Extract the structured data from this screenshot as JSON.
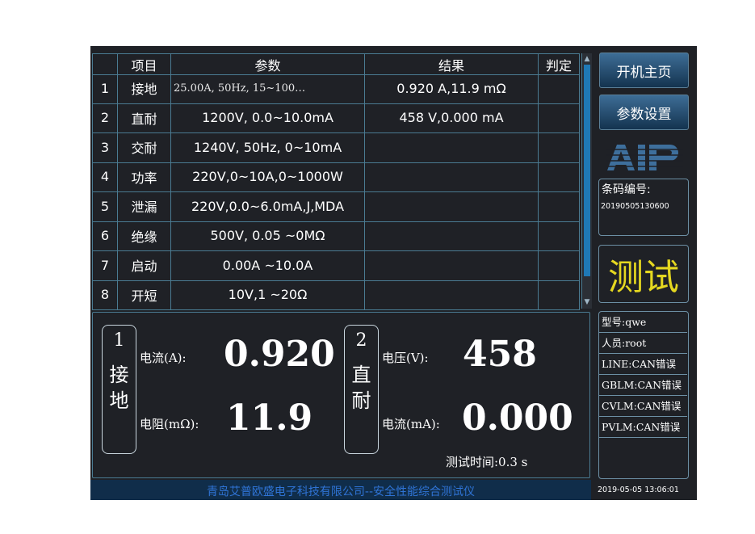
{
  "table": {
    "headers": [
      "",
      "项目",
      "参数",
      "结果",
      "判定"
    ],
    "rows": [
      {
        "no": "1",
        "item": "接地",
        "param": "25.00A,  50Hz,  15~100…",
        "result": "0.920 A,11.9 mΩ",
        "verdict": ""
      },
      {
        "no": "2",
        "item": "直耐",
        "param": "1200V, 0.0~10.0mA",
        "result": "458 V,0.000 mA",
        "verdict": ""
      },
      {
        "no": "3",
        "item": "交耐",
        "param": "1240V, 50Hz, 0~10mA",
        "result": "",
        "verdict": ""
      },
      {
        "no": "4",
        "item": "功率",
        "param": "220V,0~10A,0~1000W",
        "result": "",
        "verdict": ""
      },
      {
        "no": "5",
        "item": "泄漏",
        "param": "220V,0.0~6.0mA,J,MDA",
        "result": "",
        "verdict": ""
      },
      {
        "no": "6",
        "item": "绝缘",
        "param": "500V, 0.05 ~0MΩ",
        "result": "",
        "verdict": ""
      },
      {
        "no": "7",
        "item": "启动",
        "param": "0.00A ~10.0A",
        "result": "",
        "verdict": ""
      },
      {
        "no": "8",
        "item": "开短",
        "param": "10V,1 ~20Ω",
        "result": "",
        "verdict": ""
      }
    ]
  },
  "scrollbar": {
    "up_icon": "triangle-up",
    "down_icon": "triangle-down"
  },
  "measure": {
    "left": {
      "num": "1",
      "name_line1": "接",
      "name_line2": "地",
      "label1": "电流(A):",
      "value1": "0.920",
      "label2": "电阻(mΩ):",
      "value2": "11.9"
    },
    "right": {
      "num": "2",
      "name_line1": "直",
      "name_line2": "耐",
      "label1": "电压(V):",
      "value1": "458",
      "label2": "电流(mA):",
      "value2": "0.000"
    },
    "test_time": "测试时间:0.3  s"
  },
  "footer": {
    "company": "青岛艾普欧盛电子科技有限公司--安全性能综合测试仪"
  },
  "sidebar": {
    "home_button": "开机主页",
    "settings_button": "参数设置",
    "logo_text": "AIP",
    "barcode_label": "条码编号:",
    "barcode_value": "20190505130600",
    "test_button": "测试",
    "info": [
      "型号:qwe",
      "人员:root",
      "LINE:CAN错误",
      "GBLM:CAN错误",
      "CVLM:CAN错误",
      "PVLM:CAN错误"
    ],
    "datetime": "2019-05-05  13:06:01"
  },
  "colors": {
    "background": "#1f2126",
    "grid": "#4a7b92",
    "scroll_thumb": "#1f79b6",
    "test_text": "#e5d820",
    "footer_text": "#2f74d6"
  }
}
